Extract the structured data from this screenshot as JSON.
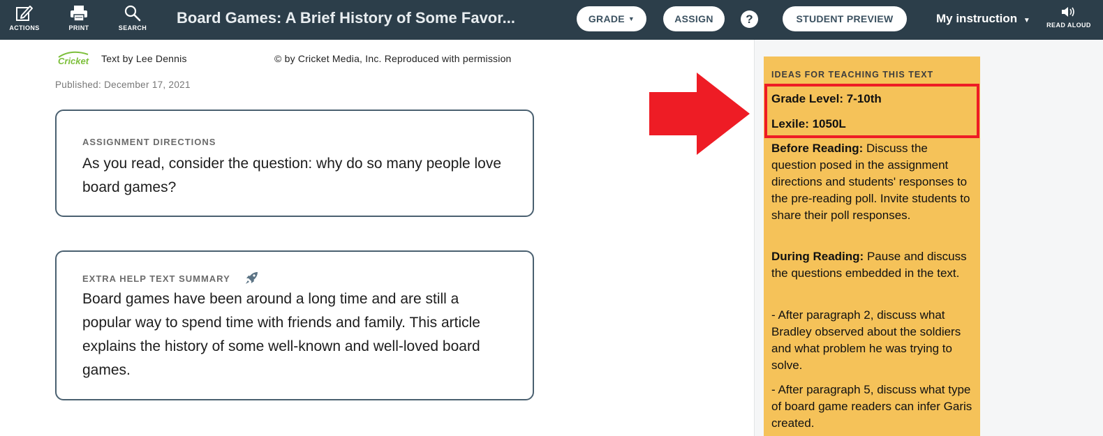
{
  "toolbar": {
    "actions_label": "ACTIONS",
    "print_label": "PRINT",
    "search_label": "SEARCH",
    "read_aloud_label": "READ ALOUD"
  },
  "header": {
    "title": "Board Games: A Brief History of Some Favor...",
    "grade_label": "GRADE",
    "assign_label": "ASSIGN",
    "help_label": "?",
    "student_preview_label": "STUDENT PREVIEW",
    "my_instruction_label": "My instruction"
  },
  "article": {
    "byline": "Text by Lee Dennis",
    "copyright": "© by Cricket Media, Inc. Reproduced with permission",
    "published": "Published: December 17, 2021",
    "logo_text": "Cricket"
  },
  "directions": {
    "heading": "ASSIGNMENT DIRECTIONS",
    "body": "As you read, consider the question: why do so many people love board games?"
  },
  "summary": {
    "heading": "EXTRA HELP TEXT SUMMARY",
    "body": "Board games have been around a long time and are still a popular way to spend time with friends and family. This article explains the history of some well-known and well-loved board games."
  },
  "teaching": {
    "heading": "IDEAS FOR TEACHING THIS TEXT",
    "grade_level": "Grade Level: 7-10th",
    "lexile": "Lexile: 1050L",
    "before_label": "Before Reading:",
    "before_text": " Discuss the question posed in the assignment directions and students' responses to the pre-reading poll. Invite students to share their poll responses.",
    "during_label": "During Reading:",
    "during_text": " Pause and discuss the questions embedded in the text.",
    "after_p2": "- After paragraph 2, discuss what Bradley observed about the soldiers and what problem he was trying to solve.",
    "after_p5": "- After paragraph 5, discuss what type of board game readers can infer Garis created."
  },
  "colors": {
    "topbar": "#2c3e4a",
    "notes_bg": "#f5c259",
    "highlight": "#ee1c25",
    "logo_green": "#7cbf3a"
  }
}
